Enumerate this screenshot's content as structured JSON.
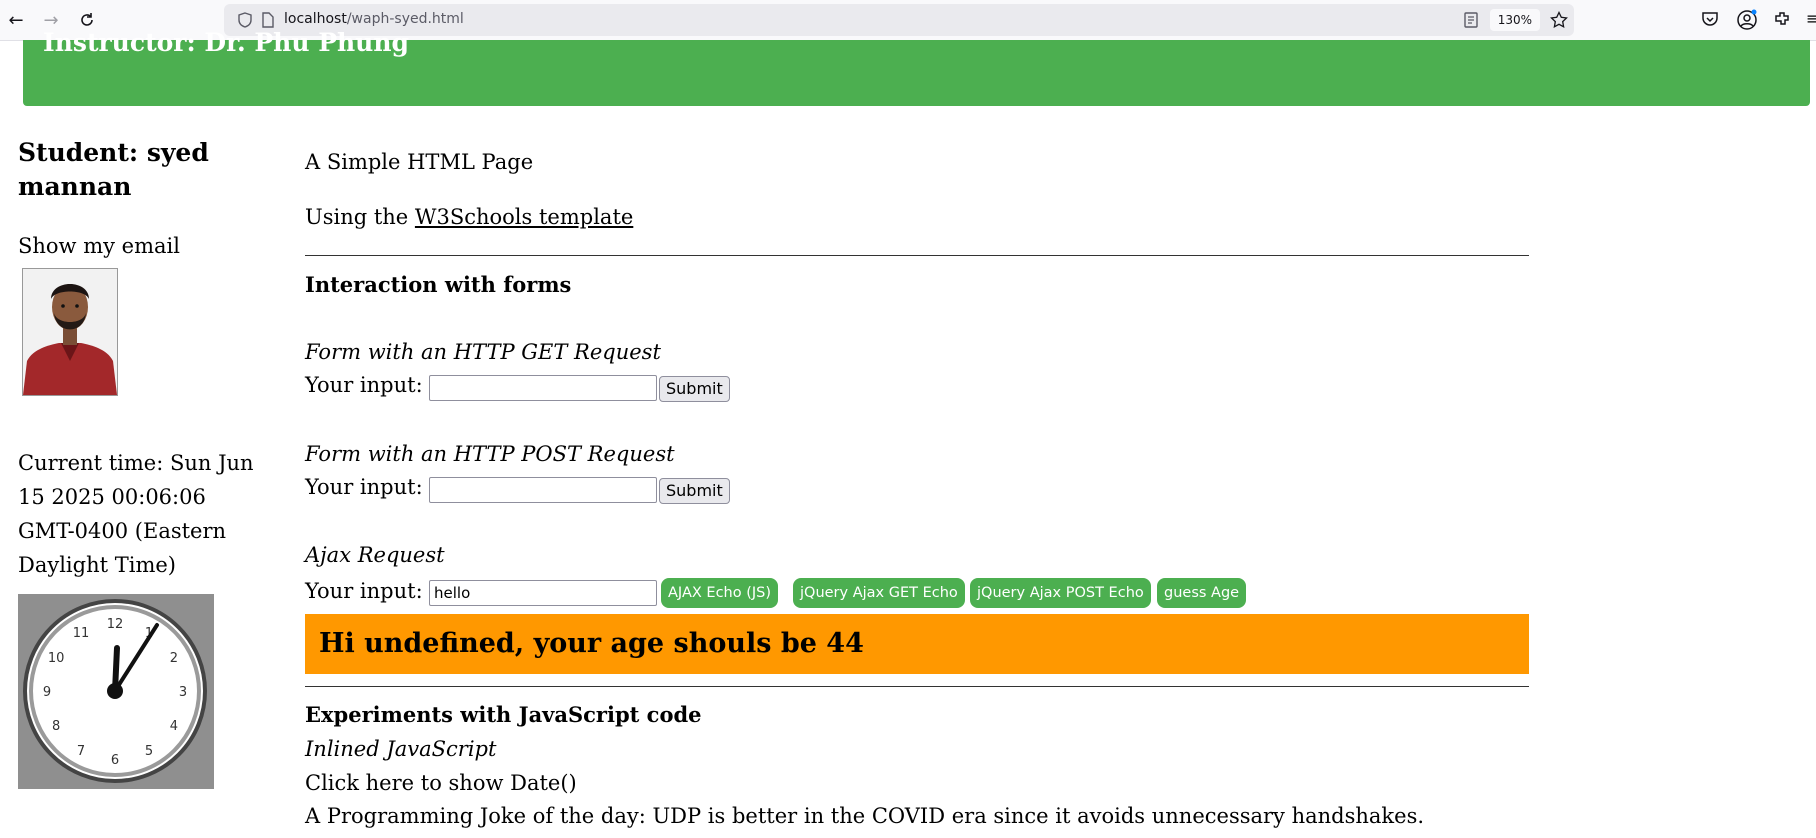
{
  "browser": {
    "url_host": "localhost",
    "url_path": "/waph-syed.html",
    "zoom": "130%"
  },
  "header": {
    "instructor": "Instructor: Dr. Phu Phung",
    "color": "#4caf50"
  },
  "sidebar": {
    "student": "Student: syed mannan",
    "email_toggle": "Show my email",
    "current_time": "Current time: Sun Jun 15 2025 00:06:06 GMT-0400 (Eastern Daylight Time)",
    "clock_numbers": [
      "12",
      "1",
      "2",
      "3",
      "4",
      "5",
      "6",
      "7",
      "8",
      "9",
      "10",
      "11"
    ]
  },
  "main": {
    "intro": "A Simple HTML Page",
    "template_prefix": "Using the ",
    "template_link": "W3Schools template",
    "forms_heading": "Interaction with forms",
    "get_heading": "Form with an HTTP GET Request",
    "post_heading": "Form with an HTTP POST Request",
    "ajax_heading": "Ajax Request",
    "input_label": "Your input:",
    "submit_label": "Submit",
    "ajax_input_value": "hello",
    "buttons": {
      "ajax_echo": "AJAX Echo (JS)",
      "jquery_get": "jQuery Ajax GET Echo",
      "jquery_post": "jQuery Ajax POST Echo",
      "guess_age": "guess Age"
    },
    "age_message": "Hi undefined, your age shouls be 44",
    "age_color": "#ff9800",
    "js_heading": "Experiments with JavaScript code",
    "inline_js": "Inlined JavaScript",
    "show_date": "Click here to show Date()",
    "joke": "A Programming Joke of the day: UDP is better in the COVID era since it avoids unnecessary handshakes."
  }
}
